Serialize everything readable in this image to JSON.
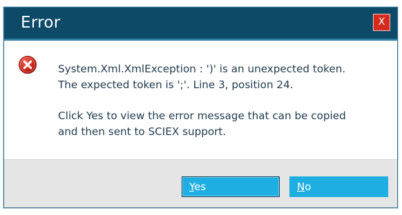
{
  "dialog": {
    "title": "Error",
    "close_label": "X",
    "message_line1": "System.Xml.XmlException : ')' is an unexpected token.",
    "message_line2": "The expected token is ';'. Line 3, position 24.",
    "prompt_line1": "Click Yes to view the error message that can be copied",
    "prompt_line2": "and then sent to SCIEX support.",
    "yes_accel": "Y",
    "yes_rest": "es",
    "no_accel": "N",
    "no_rest": "o"
  },
  "colors": {
    "titlebar": "#0c4a67",
    "close": "#d52b1e",
    "button": "#1eaee2",
    "footer": "#e5e5e5",
    "error_icon": "#c81e1e"
  },
  "icons": {
    "status": "error-icon",
    "close": "close-icon"
  }
}
